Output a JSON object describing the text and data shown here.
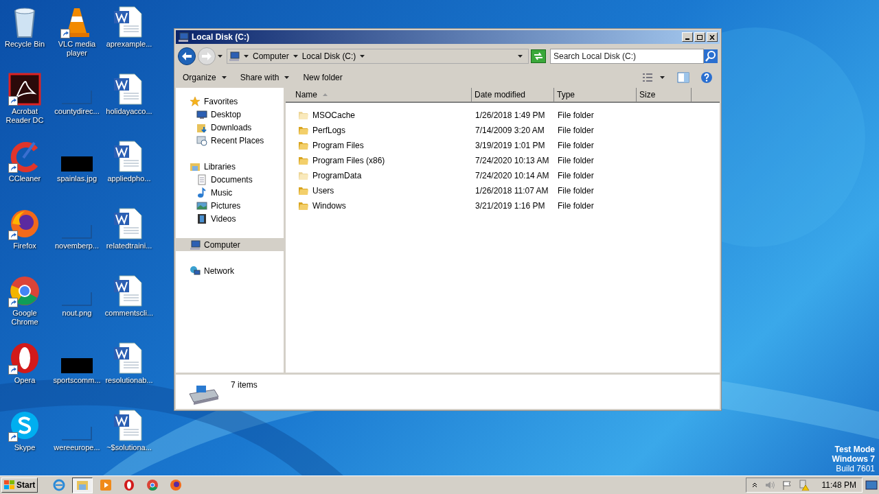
{
  "desktop_icons": [
    {
      "label": "Recycle Bin",
      "kind": "recycle",
      "shortcut": false
    },
    {
      "label": "VLC media player",
      "kind": "vlc",
      "shortcut": true
    },
    {
      "label": "aprexample...",
      "kind": "word",
      "shortcut": false
    },
    {
      "label": "Acrobat Reader DC",
      "kind": "acrobat",
      "shortcut": true
    },
    {
      "label": "countydirec...",
      "kind": "thumb",
      "shortcut": false
    },
    {
      "label": "holidayacco...",
      "kind": "word",
      "shortcut": false
    },
    {
      "label": "CCleaner",
      "kind": "ccleaner",
      "shortcut": true
    },
    {
      "label": "spainlas.jpg",
      "kind": "dark",
      "shortcut": false
    },
    {
      "label": "appliedpho...",
      "kind": "word",
      "shortcut": false
    },
    {
      "label": "Firefox",
      "kind": "firefox",
      "shortcut": true
    },
    {
      "label": "novemberp...",
      "kind": "thumb",
      "shortcut": false
    },
    {
      "label": "relatedtraini...",
      "kind": "word",
      "shortcut": false
    },
    {
      "label": "Google Chrome",
      "kind": "chrome",
      "shortcut": true
    },
    {
      "label": "nout.png",
      "kind": "thumb",
      "shortcut": false
    },
    {
      "label": "commentscli...",
      "kind": "word",
      "shortcut": false
    },
    {
      "label": "Opera",
      "kind": "opera",
      "shortcut": true
    },
    {
      "label": "sportscomm...",
      "kind": "dark",
      "shortcut": false
    },
    {
      "label": "resolutionab...",
      "kind": "word",
      "shortcut": false
    },
    {
      "label": "Skype",
      "kind": "skype",
      "shortcut": true
    },
    {
      "label": "wereeurope...",
      "kind": "thumb",
      "shortcut": false
    },
    {
      "label": "~$solutiona...",
      "kind": "word",
      "shortcut": false
    }
  ],
  "window": {
    "title": "Local Disk (C:)",
    "breadcrumb": [
      "Computer",
      "Local Disk (C:)"
    ],
    "search": {
      "placeholder": "Search Local Disk (C:)"
    },
    "toolbar": [
      {
        "label": "Organize",
        "dropdown": true
      },
      {
        "label": "Share with",
        "dropdown": true
      },
      {
        "label": "New folder",
        "dropdown": false
      }
    ],
    "nav": [
      {
        "label": "Favorites",
        "kind": "star",
        "selected": false,
        "children": [
          {
            "label": "Desktop",
            "kind": "desktop",
            "selected": false
          },
          {
            "label": "Downloads",
            "kind": "downloads",
            "selected": false
          },
          {
            "label": "Recent Places",
            "kind": "recent",
            "selected": false
          }
        ]
      },
      {
        "label": "Libraries",
        "kind": "libraries",
        "selected": false,
        "children": [
          {
            "label": "Documents",
            "kind": "documents",
            "selected": false
          },
          {
            "label": "Music",
            "kind": "music",
            "selected": false
          },
          {
            "label": "Pictures",
            "kind": "pictures",
            "selected": false
          },
          {
            "label": "Videos",
            "kind": "videos",
            "selected": false
          }
        ]
      },
      {
        "label": "Computer",
        "kind": "computer",
        "selected": true
      },
      {
        "label": "Network",
        "kind": "network",
        "selected": false
      }
    ],
    "columns": [
      "Name",
      "Date modified",
      "Type",
      "Size"
    ],
    "rows": [
      {
        "name": "MSOCache",
        "date": "1/26/2018 1:49 PM",
        "type": "File folder",
        "hidden": true
      },
      {
        "name": "PerfLogs",
        "date": "7/14/2009 3:20 AM",
        "type": "File folder",
        "hidden": false
      },
      {
        "name": "Program Files",
        "date": "3/19/2019 1:01 PM",
        "type": "File folder",
        "hidden": false
      },
      {
        "name": "Program Files (x86)",
        "date": "7/24/2020 10:13 AM",
        "type": "File folder",
        "hidden": false
      },
      {
        "name": "ProgramData",
        "date": "7/24/2020 10:14 AM",
        "type": "File folder",
        "hidden": true
      },
      {
        "name": "Users",
        "date": "1/26/2018 11:07 AM",
        "type": "File folder",
        "hidden": false
      },
      {
        "name": "Windows",
        "date": "3/21/2019 1:16 PM",
        "type": "File folder",
        "hidden": false
      }
    ],
    "status": "7 items"
  },
  "test_mode": [
    "Test Mode",
    "Windows 7",
    "Build 7601"
  ],
  "taskbar": {
    "start": "Start",
    "apps": [
      {
        "kind": "ie",
        "selected": false
      },
      {
        "kind": "explorer",
        "selected": true
      },
      {
        "kind": "media",
        "selected": false
      },
      {
        "kind": "opera",
        "selected": false
      },
      {
        "kind": "chrome",
        "selected": false
      },
      {
        "kind": "firefox",
        "selected": false
      }
    ],
    "clock": "11:48 PM"
  }
}
